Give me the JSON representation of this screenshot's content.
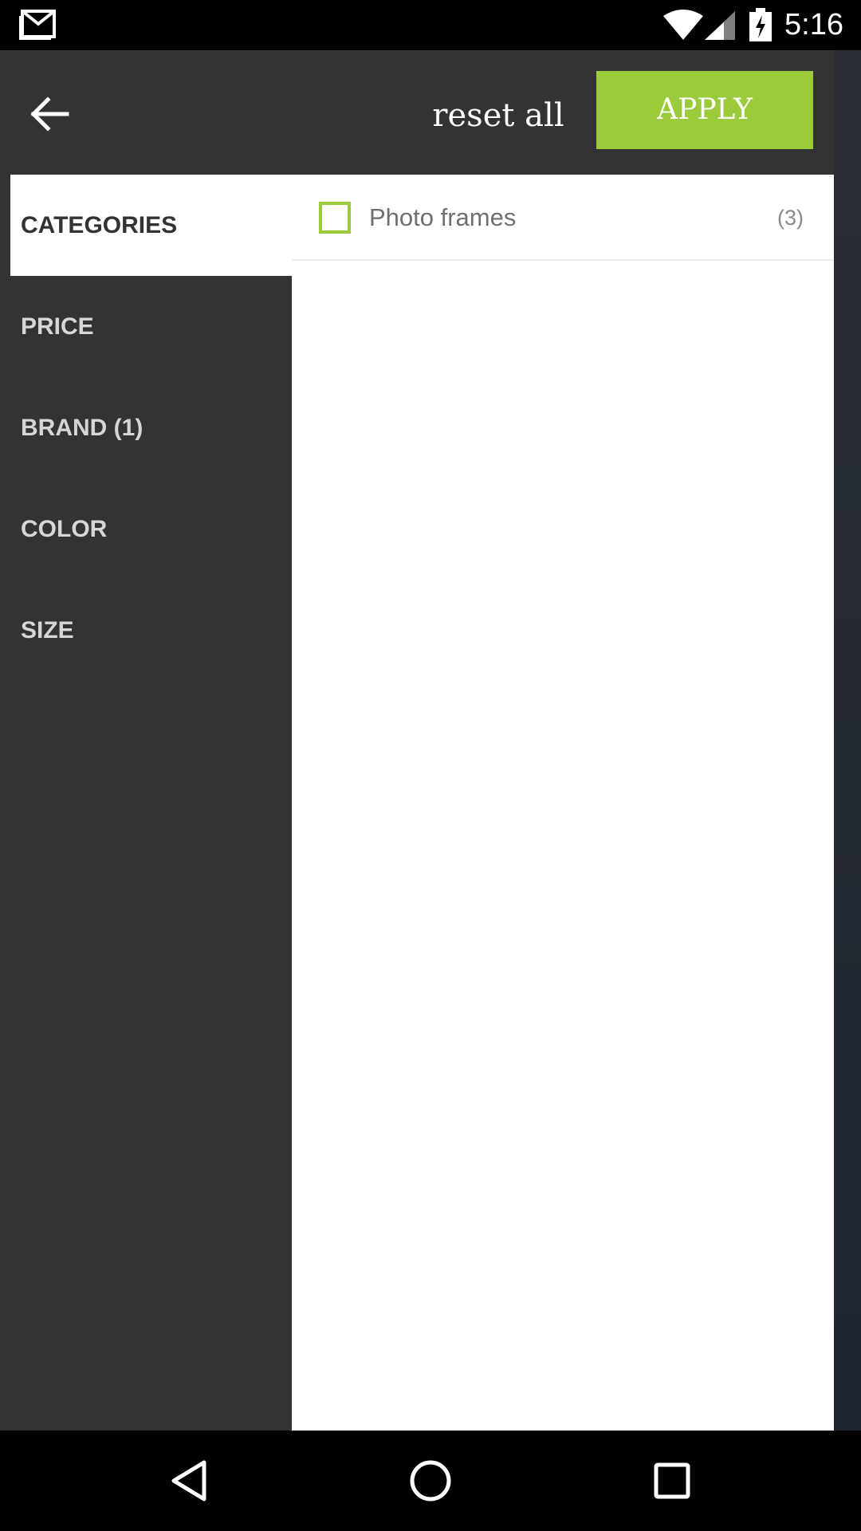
{
  "status_bar": {
    "time": "5:16",
    "icons": [
      "gmail-icon",
      "wifi-icon",
      "signal-icon",
      "battery-charging-icon"
    ]
  },
  "header": {
    "back_icon": "arrow-left-icon",
    "reset_label": "reset all",
    "apply_label": "APPLY"
  },
  "sidebar": {
    "items": [
      {
        "label": "CATEGORIES",
        "active": true
      },
      {
        "label": "PRICE",
        "active": false
      },
      {
        "label": "BRAND (1)",
        "active": false
      },
      {
        "label": "COLOR",
        "active": false
      },
      {
        "label": "SIZE",
        "active": false
      }
    ]
  },
  "content": {
    "options": [
      {
        "label": "Photo frames",
        "count": "(3)",
        "checked": false
      }
    ]
  },
  "colors": {
    "accent": "#9bcb3b",
    "panel": "#333333",
    "content_bg": "#ffffff"
  },
  "nav_bar": {
    "icons": [
      "back-triangle-icon",
      "home-circle-icon",
      "recents-square-icon"
    ]
  }
}
